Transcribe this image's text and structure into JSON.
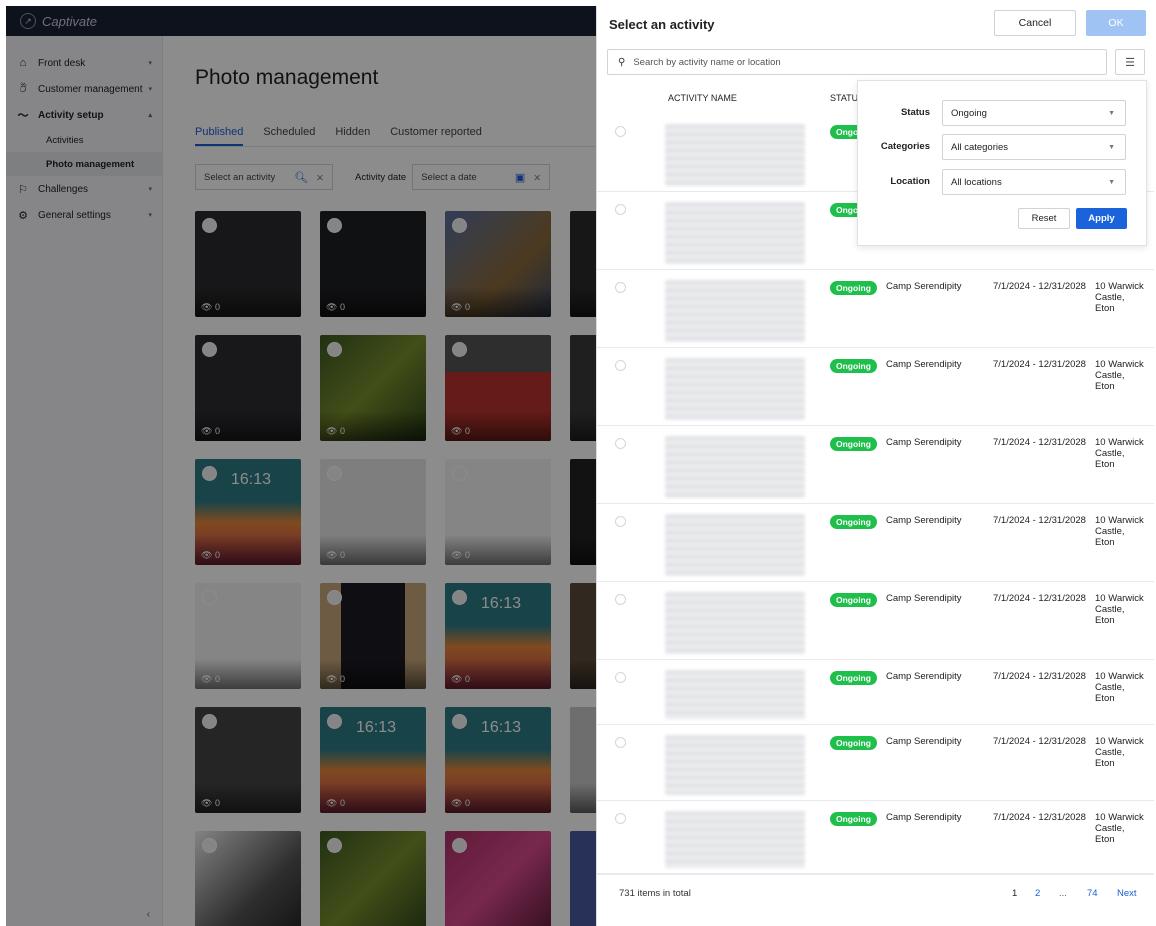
{
  "app": {
    "name": "Captivate"
  },
  "sidebar": {
    "items": [
      {
        "label": "Front desk",
        "icon": "home-icon"
      },
      {
        "label": "Customer management",
        "icon": "customer-icon"
      },
      {
        "label": "Activity setup",
        "icon": "activity-icon"
      },
      {
        "label": "Challenges",
        "icon": "flag-icon"
      },
      {
        "label": "General settings",
        "icon": "gear-icon"
      }
    ],
    "subitems": [
      {
        "label": "Activities"
      },
      {
        "label": "Photo management"
      }
    ],
    "collapse": "‹"
  },
  "main": {
    "title": "Photo management",
    "tabs": [
      "Published",
      "Scheduled",
      "Hidden",
      "Customer reported"
    ],
    "activity_placeholder": "Select an activity",
    "date_label": "Activity date",
    "date_placeholder": "Select a date"
  },
  "tiles": {
    "views": "0",
    "clock": "16:13"
  },
  "drawer": {
    "title": "Select an activity",
    "cancel": "Cancel",
    "ok": "OK",
    "search_placeholder": "Search by activity name or location",
    "columns": {
      "name": "ACTIVITY NAME",
      "status": "STATUS"
    },
    "rows": [
      {
        "status": "Ongoing",
        "category": "",
        "date": "",
        "location": ""
      },
      {
        "status": "Ongoing",
        "category": "",
        "date": "",
        "location": ""
      },
      {
        "status": "Ongoing",
        "category": "Camp Serendipity",
        "date": "7/1/2024 - 12/31/2028",
        "location": "10 Warwick Castle, Eton"
      },
      {
        "status": "Ongoing",
        "category": "Camp Serendipity",
        "date": "7/1/2024 - 12/31/2028",
        "location": "10 Warwick Castle, Eton"
      },
      {
        "status": "Ongoing",
        "category": "Camp Serendipity",
        "date": "7/1/2024 - 12/31/2028",
        "location": "10 Warwick Castle, Eton"
      },
      {
        "status": "Ongoing",
        "category": "Camp Serendipity",
        "date": "7/1/2024 - 12/31/2028",
        "location": "10 Warwick Castle, Eton"
      },
      {
        "status": "Ongoing",
        "category": "Camp Serendipity",
        "date": "7/1/2024 - 12/31/2028",
        "location": "10 Warwick Castle, Eton"
      },
      {
        "status": "Ongoing",
        "category": "Camp Serendipity",
        "date": "7/1/2024 - 12/31/2028",
        "location": "10 Warwick Castle, Eton"
      },
      {
        "status": "Ongoing",
        "category": "Camp Serendipity",
        "date": "7/1/2024 - 12/31/2028",
        "location": "10 Warwick Castle, Eton"
      },
      {
        "status": "Ongoing",
        "category": "Camp Serendipity",
        "date": "7/1/2024 - 12/31/2028",
        "location": "10 Warwick Castle, Eton"
      }
    ],
    "total": "731 items in total",
    "pagination": {
      "p1": "1",
      "p2": "2",
      "ellipsis": "...",
      "last": "74",
      "next": "Next"
    }
  },
  "filter_popover": {
    "status_label": "Status",
    "status_value": "Ongoing",
    "categories_label": "Categories",
    "categories_value": "All categories",
    "location_label": "Location",
    "location_value": "All locations",
    "reset": "Reset",
    "apply": "Apply"
  },
  "colors": {
    "accent": "#1a63db",
    "ongoing": "#1fbf4c",
    "ok_disabled": "#9fc3f3",
    "topbar": "#1b2233"
  }
}
